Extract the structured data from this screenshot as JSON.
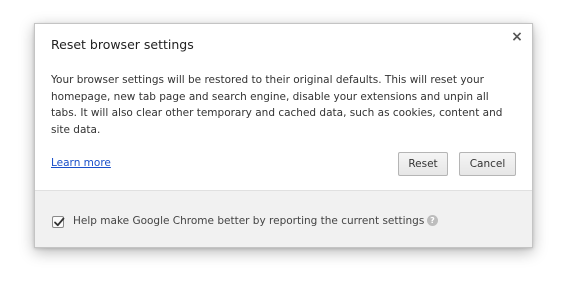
{
  "dialog": {
    "title": "Reset browser settings",
    "close_glyph": "×",
    "body_text": "Your browser settings will be restored to their original defaults. This will reset your homepage, new tab page and search engine, disable your extensions and unpin all tabs. It will also clear other temporary and cached data, such as cookies, content and site data.",
    "learn_more": "Learn more",
    "reset_label": "Reset",
    "cancel_label": "Cancel"
  },
  "footer": {
    "checkbox_checked": true,
    "checkbox_label": "Help make Google Chrome better by reporting the current settings",
    "help_glyph": "?"
  },
  "colors": {
    "link": "#1a4fc9",
    "footer_bg": "#f1f1f1"
  },
  "icons": [
    "close-icon",
    "checkmark-icon",
    "help-icon"
  ]
}
